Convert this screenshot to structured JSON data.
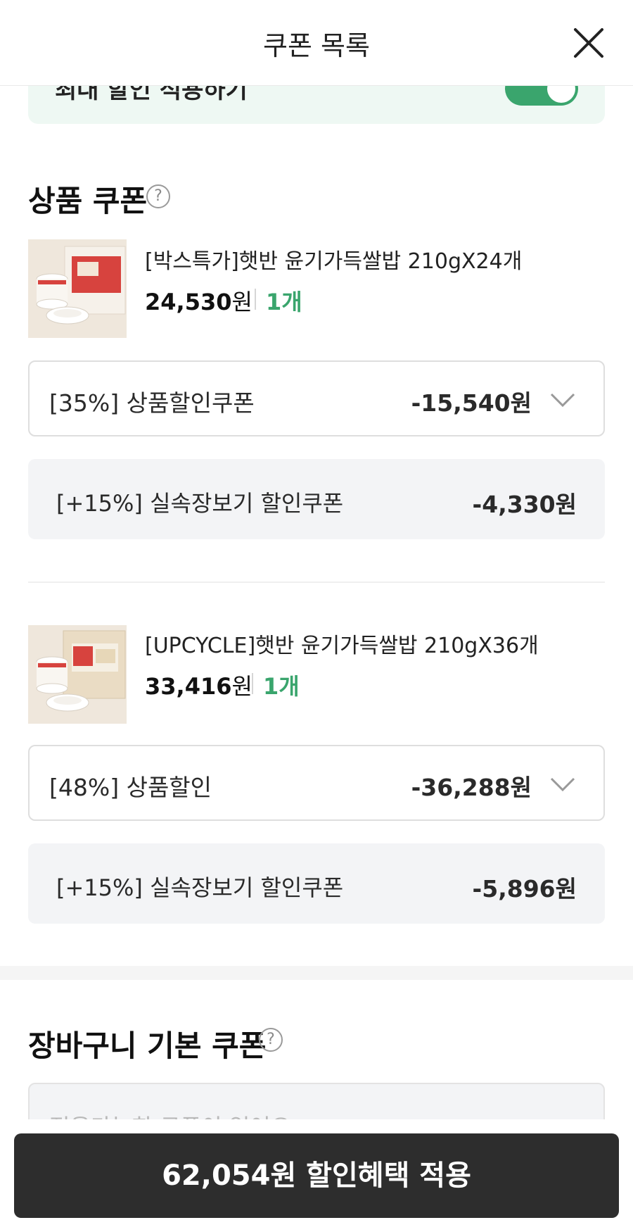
{
  "header": {
    "title": "쿠폰 목록"
  },
  "toggle": {
    "label": "최대 할인 적용하기",
    "on": true,
    "color": "#3aa56d"
  },
  "product_coupons": {
    "title": "상품 쿠폰",
    "help": "?",
    "items": [
      {
        "name": "[박스특가]햇반 윤기가득쌀밥 210gX24개",
        "price": "24,530",
        "won": "원",
        "qty": "1개",
        "selected_coupon": {
          "label": "[35%] 상품할인쿠폰",
          "amount": "-15,540원"
        },
        "extra_coupon": {
          "label": "[+15%] 실속장보기 할인쿠폰",
          "amount": "-4,330원"
        }
      },
      {
        "name": "[UPCYCLE]햇반 윤기가득쌀밥 210gX36개",
        "price": "33,416",
        "won": "원",
        "qty": "1개",
        "selected_coupon": {
          "label": "[48%] 상품할인",
          "amount": "-36,288원"
        },
        "extra_coupon": {
          "label": "[+15%] 실속장보기 할인쿠폰",
          "amount": "-5,896원"
        }
      }
    ]
  },
  "cart_coupons": {
    "title": "장바구니 기본 쿠폰",
    "help": "?",
    "empty_text": "적용가능한 쿠폰이 없어요"
  },
  "apply_button": {
    "label": "62,054원 할인혜택 적용"
  },
  "colors": {
    "accent": "#3aa56d",
    "button": "#2d2d2d",
    "panel": "#f3f4f6"
  }
}
